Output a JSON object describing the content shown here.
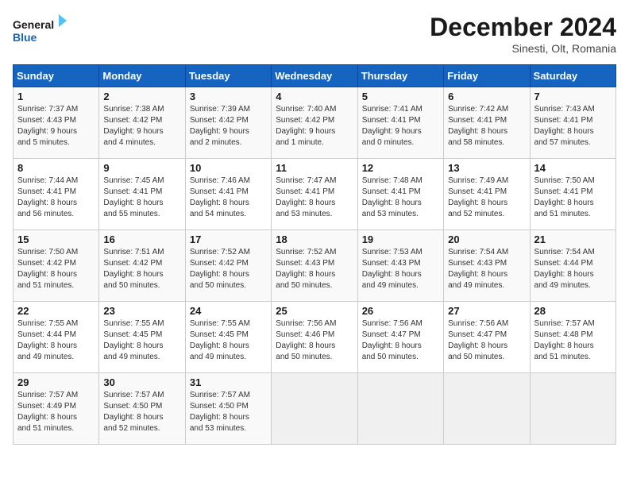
{
  "header": {
    "logo_line1": "General",
    "logo_line2": "Blue",
    "month": "December 2024",
    "location": "Sinesti, Olt, Romania"
  },
  "days_of_week": [
    "Sunday",
    "Monday",
    "Tuesday",
    "Wednesday",
    "Thursday",
    "Friday",
    "Saturday"
  ],
  "weeks": [
    [
      {
        "day": "1",
        "info": "Sunrise: 7:37 AM\nSunset: 4:43 PM\nDaylight: 9 hours\nand 5 minutes."
      },
      {
        "day": "2",
        "info": "Sunrise: 7:38 AM\nSunset: 4:42 PM\nDaylight: 9 hours\nand 4 minutes."
      },
      {
        "day": "3",
        "info": "Sunrise: 7:39 AM\nSunset: 4:42 PM\nDaylight: 9 hours\nand 2 minutes."
      },
      {
        "day": "4",
        "info": "Sunrise: 7:40 AM\nSunset: 4:42 PM\nDaylight: 9 hours\nand 1 minute."
      },
      {
        "day": "5",
        "info": "Sunrise: 7:41 AM\nSunset: 4:41 PM\nDaylight: 9 hours\nand 0 minutes."
      },
      {
        "day": "6",
        "info": "Sunrise: 7:42 AM\nSunset: 4:41 PM\nDaylight: 8 hours\nand 58 minutes."
      },
      {
        "day": "7",
        "info": "Sunrise: 7:43 AM\nSunset: 4:41 PM\nDaylight: 8 hours\nand 57 minutes."
      }
    ],
    [
      {
        "day": "8",
        "info": "Sunrise: 7:44 AM\nSunset: 4:41 PM\nDaylight: 8 hours\nand 56 minutes."
      },
      {
        "day": "9",
        "info": "Sunrise: 7:45 AM\nSunset: 4:41 PM\nDaylight: 8 hours\nand 55 minutes."
      },
      {
        "day": "10",
        "info": "Sunrise: 7:46 AM\nSunset: 4:41 PM\nDaylight: 8 hours\nand 54 minutes."
      },
      {
        "day": "11",
        "info": "Sunrise: 7:47 AM\nSunset: 4:41 PM\nDaylight: 8 hours\nand 53 minutes."
      },
      {
        "day": "12",
        "info": "Sunrise: 7:48 AM\nSunset: 4:41 PM\nDaylight: 8 hours\nand 53 minutes."
      },
      {
        "day": "13",
        "info": "Sunrise: 7:49 AM\nSunset: 4:41 PM\nDaylight: 8 hours\nand 52 minutes."
      },
      {
        "day": "14",
        "info": "Sunrise: 7:50 AM\nSunset: 4:41 PM\nDaylight: 8 hours\nand 51 minutes."
      }
    ],
    [
      {
        "day": "15",
        "info": "Sunrise: 7:50 AM\nSunset: 4:42 PM\nDaylight: 8 hours\nand 51 minutes."
      },
      {
        "day": "16",
        "info": "Sunrise: 7:51 AM\nSunset: 4:42 PM\nDaylight: 8 hours\nand 50 minutes."
      },
      {
        "day": "17",
        "info": "Sunrise: 7:52 AM\nSunset: 4:42 PM\nDaylight: 8 hours\nand 50 minutes."
      },
      {
        "day": "18",
        "info": "Sunrise: 7:52 AM\nSunset: 4:43 PM\nDaylight: 8 hours\nand 50 minutes."
      },
      {
        "day": "19",
        "info": "Sunrise: 7:53 AM\nSunset: 4:43 PM\nDaylight: 8 hours\nand 49 minutes."
      },
      {
        "day": "20",
        "info": "Sunrise: 7:54 AM\nSunset: 4:43 PM\nDaylight: 8 hours\nand 49 minutes."
      },
      {
        "day": "21",
        "info": "Sunrise: 7:54 AM\nSunset: 4:44 PM\nDaylight: 8 hours\nand 49 minutes."
      }
    ],
    [
      {
        "day": "22",
        "info": "Sunrise: 7:55 AM\nSunset: 4:44 PM\nDaylight: 8 hours\nand 49 minutes."
      },
      {
        "day": "23",
        "info": "Sunrise: 7:55 AM\nSunset: 4:45 PM\nDaylight: 8 hours\nand 49 minutes."
      },
      {
        "day": "24",
        "info": "Sunrise: 7:55 AM\nSunset: 4:45 PM\nDaylight: 8 hours\nand 49 minutes."
      },
      {
        "day": "25",
        "info": "Sunrise: 7:56 AM\nSunset: 4:46 PM\nDaylight: 8 hours\nand 50 minutes."
      },
      {
        "day": "26",
        "info": "Sunrise: 7:56 AM\nSunset: 4:47 PM\nDaylight: 8 hours\nand 50 minutes."
      },
      {
        "day": "27",
        "info": "Sunrise: 7:56 AM\nSunset: 4:47 PM\nDaylight: 8 hours\nand 50 minutes."
      },
      {
        "day": "28",
        "info": "Sunrise: 7:57 AM\nSunset: 4:48 PM\nDaylight: 8 hours\nand 51 minutes."
      }
    ],
    [
      {
        "day": "29",
        "info": "Sunrise: 7:57 AM\nSunset: 4:49 PM\nDaylight: 8 hours\nand 51 minutes."
      },
      {
        "day": "30",
        "info": "Sunrise: 7:57 AM\nSunset: 4:50 PM\nDaylight: 8 hours\nand 52 minutes."
      },
      {
        "day": "31",
        "info": "Sunrise: 7:57 AM\nSunset: 4:50 PM\nDaylight: 8 hours\nand 53 minutes."
      },
      null,
      null,
      null,
      null
    ]
  ]
}
